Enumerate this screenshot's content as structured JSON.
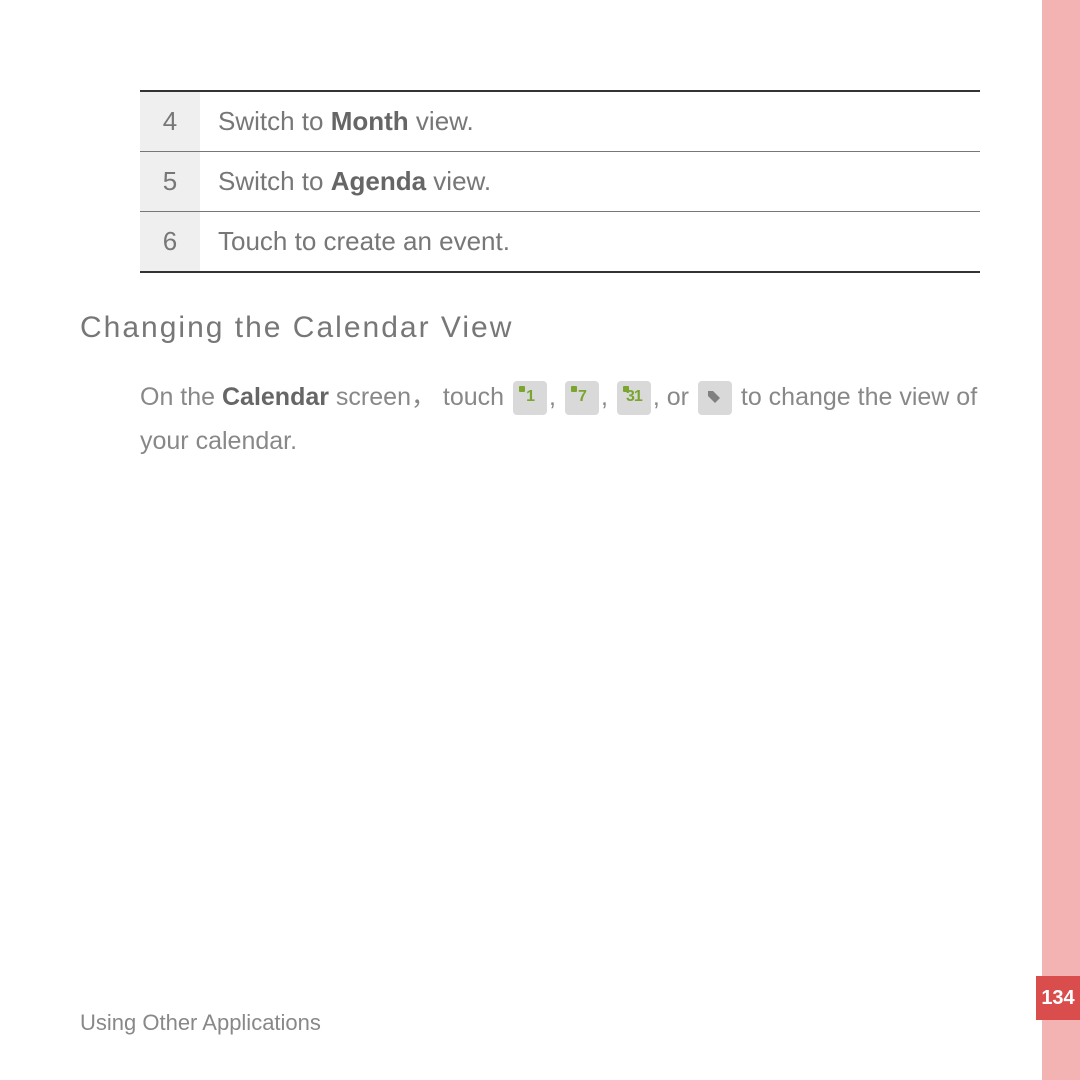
{
  "table": {
    "rows": [
      {
        "num": "4",
        "prefix": "Switch to ",
        "bold": "Month",
        "suffix": " view."
      },
      {
        "num": "5",
        "prefix": "Switch to ",
        "bold": "Agenda",
        "suffix": " view."
      },
      {
        "num": "6",
        "prefix": "Touch to create an event.",
        "bold": "",
        "suffix": ""
      }
    ]
  },
  "heading": "Changing  the  Calendar  View",
  "paragraph": {
    "p1": "On the ",
    "b1": "Calendar",
    "p2": " screen，  touch ",
    "sep": ", ",
    "or": ", or ",
    "p3": " to change the view of your calendar."
  },
  "icons": {
    "day": "1",
    "week": "7",
    "month": "31"
  },
  "footer": "Using Other Applications",
  "page_number": "134"
}
